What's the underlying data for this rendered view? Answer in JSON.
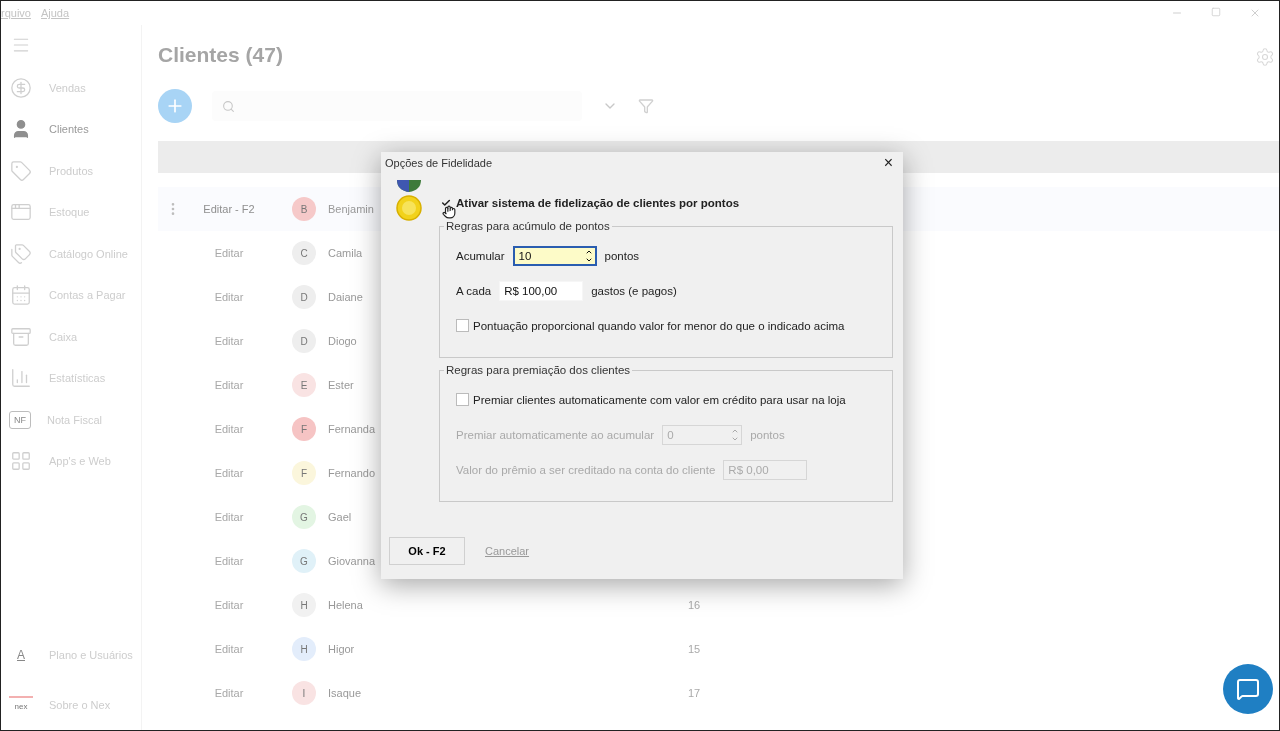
{
  "menu": [
    {
      "label": "rquivo"
    },
    {
      "label": "Ajuda"
    }
  ],
  "sidebar": {
    "items": [
      {
        "label": "Vendas",
        "selected": false
      },
      {
        "label": "Clientes",
        "selected": true
      },
      {
        "label": "Produtos",
        "selected": false
      },
      {
        "label": "Estoque",
        "selected": false
      },
      {
        "label": "Catálogo Online",
        "selected": false
      },
      {
        "label": "Contas a Pagar",
        "selected": false
      },
      {
        "label": "Caixa",
        "selected": false
      },
      {
        "label": "Estatísticas",
        "selected": false
      },
      {
        "label": "Nota Fiscal",
        "icon_text": "NF",
        "selected": false
      },
      {
        "label": "App's e Web",
        "selected": false
      }
    ],
    "bottom_items": [
      {
        "label": "Plano e Usuários",
        "icon_text": "A",
        "selected": false
      },
      {
        "label": "Sobre o Nex",
        "icon_text": "nex",
        "selected": false
      }
    ]
  },
  "page": {
    "title": "Clientes (47)"
  },
  "table": {
    "rows": [
      {
        "action": "Editar - F2",
        "initial": "B",
        "name": "Benjamin",
        "color": "#f6c9c9",
        "selected": true
      },
      {
        "action": "Editar",
        "initial": "C",
        "name": "Camila",
        "color": "#eeeeee",
        "selected": false
      },
      {
        "action": "Editar",
        "initial": "D",
        "name": "Daiane",
        "color": "#eeeeee",
        "selected": false
      },
      {
        "action": "Editar",
        "initial": "D",
        "name": "Diogo",
        "color": "#eeeeee",
        "selected": false
      },
      {
        "action": "Editar",
        "initial": "E",
        "name": "Ester",
        "color": "#f9e3e3",
        "selected": false
      },
      {
        "action": "Editar",
        "initial": "F",
        "name": "Fernanda",
        "color": "#f6c4c4",
        "selected": false
      },
      {
        "action": "Editar",
        "initial": "F",
        "name": "Fernando",
        "color": "#fbf6dc",
        "selected": false
      },
      {
        "action": "Editar",
        "initial": "G",
        "name": "Gael",
        "color": "#e3f5e3",
        "selected": false
      },
      {
        "action": "Editar",
        "initial": "G",
        "name": "Giovanna",
        "color": "#e0f1f8",
        "selected": false
      },
      {
        "action": "Editar",
        "initial": "H",
        "name": "Helena",
        "color": "#f1f1f1",
        "selected": false,
        "count": "16"
      },
      {
        "action": "Editar",
        "initial": "H",
        "name": "Higor",
        "color": "#e3edfb",
        "selected": false,
        "count": "15"
      },
      {
        "action": "Editar",
        "initial": "I",
        "name": "Isaque",
        "color": "#f9e3e3",
        "selected": false,
        "count": "17"
      }
    ]
  },
  "dialog": {
    "title": "Opções de Fidelidade",
    "close": "×",
    "enable": {
      "label": "Ativar sistema de fidelização de clientes por pontos",
      "checked": true
    },
    "groups": [
      {
        "legend": "Regras para acúmulo de pontos",
        "rows": [
          {
            "kind": "spin",
            "label": "Acumular",
            "value": "10",
            "suffix": "pontos",
            "disabled": false,
            "focused": true
          },
          {
            "kind": "field",
            "label": "A cada",
            "value": "R$ 100,00",
            "suffix": "gastos (e pagos)",
            "disabled": false,
            "focused": false
          },
          {
            "kind": "check",
            "label": "Pontuação proporcional quando valor for menor do que o indicado acima",
            "checked": false
          }
        ]
      },
      {
        "legend": "Regras para premiação dos clientes",
        "rows": [
          {
            "kind": "check",
            "label": "Premiar clientes automaticamente com valor em crédito para usar na loja",
            "checked": false
          },
          {
            "kind": "spin",
            "label": "Premiar automaticamente ao acumular",
            "value": "0",
            "suffix": "pontos",
            "disabled": true,
            "focused": false
          },
          {
            "kind": "field",
            "label": "Valor do prêmio a ser creditado na conta do cliente",
            "value": "R$ 0,00",
            "disabled": true,
            "focused": false
          }
        ]
      }
    ],
    "ok": "Ok - F2",
    "cancel": "Cancelar"
  }
}
